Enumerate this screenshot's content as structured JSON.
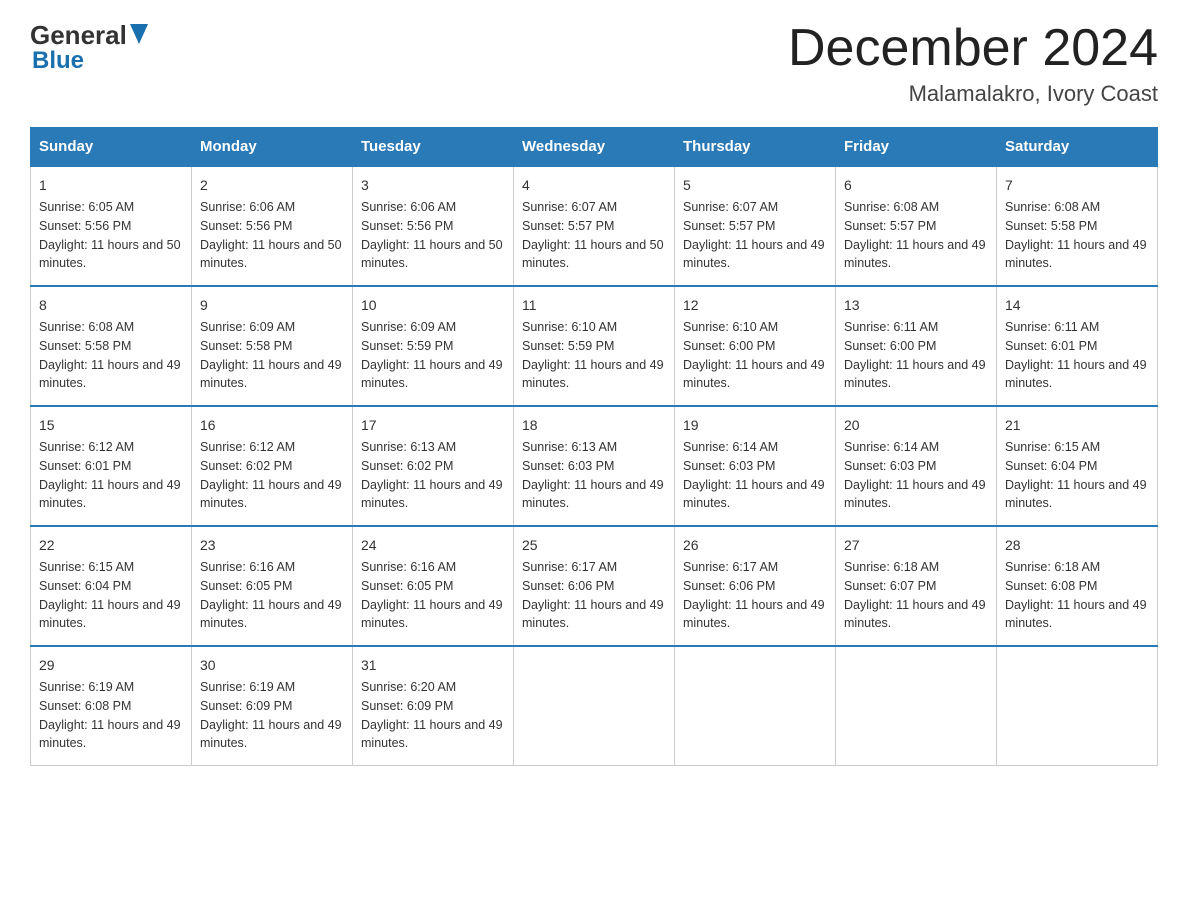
{
  "header": {
    "logo_text1": "General",
    "logo_text2": "Blue",
    "month_title": "December 2024",
    "location": "Malamalakro, Ivory Coast"
  },
  "calendar": {
    "days_of_week": [
      "Sunday",
      "Monday",
      "Tuesday",
      "Wednesday",
      "Thursday",
      "Friday",
      "Saturday"
    ],
    "weeks": [
      [
        {
          "date": "1",
          "sunrise": "6:05 AM",
          "sunset": "5:56 PM",
          "daylight": "11 hours and 50 minutes."
        },
        {
          "date": "2",
          "sunrise": "6:06 AM",
          "sunset": "5:56 PM",
          "daylight": "11 hours and 50 minutes."
        },
        {
          "date": "3",
          "sunrise": "6:06 AM",
          "sunset": "5:56 PM",
          "daylight": "11 hours and 50 minutes."
        },
        {
          "date": "4",
          "sunrise": "6:07 AM",
          "sunset": "5:57 PM",
          "daylight": "11 hours and 50 minutes."
        },
        {
          "date": "5",
          "sunrise": "6:07 AM",
          "sunset": "5:57 PM",
          "daylight": "11 hours and 49 minutes."
        },
        {
          "date": "6",
          "sunrise": "6:08 AM",
          "sunset": "5:57 PM",
          "daylight": "11 hours and 49 minutes."
        },
        {
          "date": "7",
          "sunrise": "6:08 AM",
          "sunset": "5:58 PM",
          "daylight": "11 hours and 49 minutes."
        }
      ],
      [
        {
          "date": "8",
          "sunrise": "6:08 AM",
          "sunset": "5:58 PM",
          "daylight": "11 hours and 49 minutes."
        },
        {
          "date": "9",
          "sunrise": "6:09 AM",
          "sunset": "5:58 PM",
          "daylight": "11 hours and 49 minutes."
        },
        {
          "date": "10",
          "sunrise": "6:09 AM",
          "sunset": "5:59 PM",
          "daylight": "11 hours and 49 minutes."
        },
        {
          "date": "11",
          "sunrise": "6:10 AM",
          "sunset": "5:59 PM",
          "daylight": "11 hours and 49 minutes."
        },
        {
          "date": "12",
          "sunrise": "6:10 AM",
          "sunset": "6:00 PM",
          "daylight": "11 hours and 49 minutes."
        },
        {
          "date": "13",
          "sunrise": "6:11 AM",
          "sunset": "6:00 PM",
          "daylight": "11 hours and 49 minutes."
        },
        {
          "date": "14",
          "sunrise": "6:11 AM",
          "sunset": "6:01 PM",
          "daylight": "11 hours and 49 minutes."
        }
      ],
      [
        {
          "date": "15",
          "sunrise": "6:12 AM",
          "sunset": "6:01 PM",
          "daylight": "11 hours and 49 minutes."
        },
        {
          "date": "16",
          "sunrise": "6:12 AM",
          "sunset": "6:02 PM",
          "daylight": "11 hours and 49 minutes."
        },
        {
          "date": "17",
          "sunrise": "6:13 AM",
          "sunset": "6:02 PM",
          "daylight": "11 hours and 49 minutes."
        },
        {
          "date": "18",
          "sunrise": "6:13 AM",
          "sunset": "6:03 PM",
          "daylight": "11 hours and 49 minutes."
        },
        {
          "date": "19",
          "sunrise": "6:14 AM",
          "sunset": "6:03 PM",
          "daylight": "11 hours and 49 minutes."
        },
        {
          "date": "20",
          "sunrise": "6:14 AM",
          "sunset": "6:03 PM",
          "daylight": "11 hours and 49 minutes."
        },
        {
          "date": "21",
          "sunrise": "6:15 AM",
          "sunset": "6:04 PM",
          "daylight": "11 hours and 49 minutes."
        }
      ],
      [
        {
          "date": "22",
          "sunrise": "6:15 AM",
          "sunset": "6:04 PM",
          "daylight": "11 hours and 49 minutes."
        },
        {
          "date": "23",
          "sunrise": "6:16 AM",
          "sunset": "6:05 PM",
          "daylight": "11 hours and 49 minutes."
        },
        {
          "date": "24",
          "sunrise": "6:16 AM",
          "sunset": "6:05 PM",
          "daylight": "11 hours and 49 minutes."
        },
        {
          "date": "25",
          "sunrise": "6:17 AM",
          "sunset": "6:06 PM",
          "daylight": "11 hours and 49 minutes."
        },
        {
          "date": "26",
          "sunrise": "6:17 AM",
          "sunset": "6:06 PM",
          "daylight": "11 hours and 49 minutes."
        },
        {
          "date": "27",
          "sunrise": "6:18 AM",
          "sunset": "6:07 PM",
          "daylight": "11 hours and 49 minutes."
        },
        {
          "date": "28",
          "sunrise": "6:18 AM",
          "sunset": "6:08 PM",
          "daylight": "11 hours and 49 minutes."
        }
      ],
      [
        {
          "date": "29",
          "sunrise": "6:19 AM",
          "sunset": "6:08 PM",
          "daylight": "11 hours and 49 minutes."
        },
        {
          "date": "30",
          "sunrise": "6:19 AM",
          "sunset": "6:09 PM",
          "daylight": "11 hours and 49 minutes."
        },
        {
          "date": "31",
          "sunrise": "6:20 AM",
          "sunset": "6:09 PM",
          "daylight": "11 hours and 49 minutes."
        },
        null,
        null,
        null,
        null
      ]
    ]
  }
}
